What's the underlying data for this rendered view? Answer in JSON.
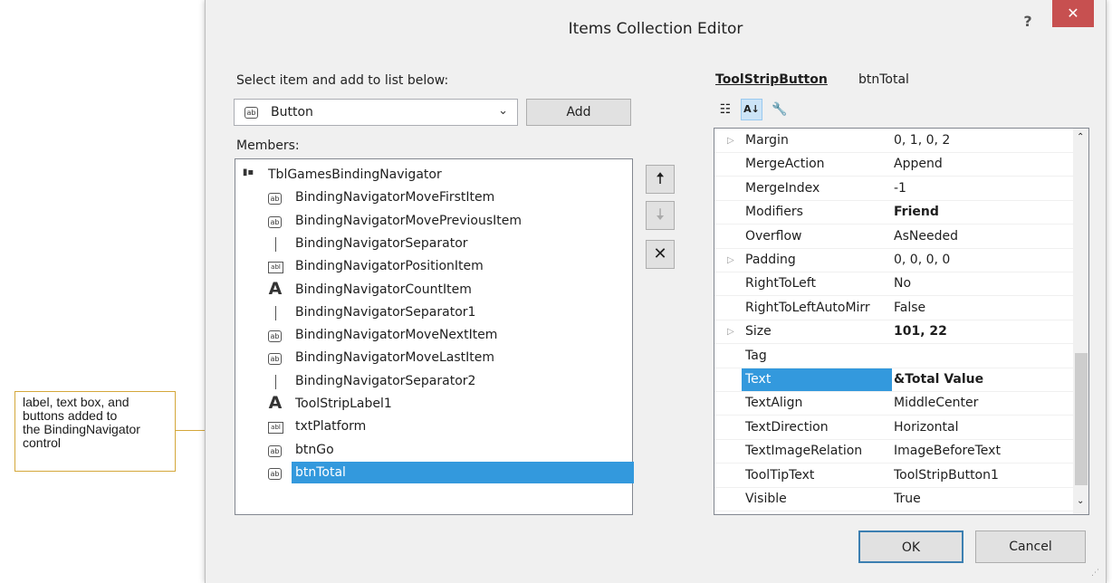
{
  "callout": {
    "text": "label, text box, and\nbuttons added to\nthe BindingNavigator\ncontrol"
  },
  "dialog": {
    "title": "Items Collection Editor",
    "help_label": "?",
    "close_label": "✕",
    "select_label": "Select item and add to list below:",
    "combo_value": "Button",
    "combo_icon": "ab",
    "add_label": "Add",
    "members_label": "Members:",
    "members": [
      {
        "icon": "toolstrip",
        "label": "TblGamesBindingNavigator"
      },
      {
        "icon": "ab",
        "label": "BindingNavigatorMoveFirstItem"
      },
      {
        "icon": "ab",
        "label": "BindingNavigatorMovePreviousItem"
      },
      {
        "icon": "sep",
        "label": "BindingNavigatorSeparator"
      },
      {
        "icon": "abl",
        "label": "BindingNavigatorPositionItem"
      },
      {
        "icon": "A",
        "label": "BindingNavigatorCountItem"
      },
      {
        "icon": "sep",
        "label": "BindingNavigatorSeparator1"
      },
      {
        "icon": "ab",
        "label": "BindingNavigatorMoveNextItem"
      },
      {
        "icon": "ab",
        "label": "BindingNavigatorMoveLastItem"
      },
      {
        "icon": "sep",
        "label": "BindingNavigatorSeparator2"
      },
      {
        "icon": "A",
        "label": "ToolStripLabel1"
      },
      {
        "icon": "abl",
        "label": "txtPlatform"
      },
      {
        "icon": "ab",
        "label": "btnGo"
      },
      {
        "icon": "ab",
        "label": "btnTotal"
      }
    ],
    "side_buttons": {
      "up": "🠅",
      "down": "🠇",
      "delete": "✕"
    },
    "props_type": "ToolStripButton",
    "props_name": "btnTotal",
    "properties": [
      {
        "name": "Margin",
        "value": "0, 1, 0, 2",
        "expand": "▷",
        "bold": false
      },
      {
        "name": "MergeAction",
        "value": "Append",
        "expand": "",
        "bold": false
      },
      {
        "name": "MergeIndex",
        "value": "-1",
        "expand": "",
        "bold": false
      },
      {
        "name": "Modifiers",
        "value": "Friend",
        "expand": "",
        "bold": true
      },
      {
        "name": "Overflow",
        "value": "AsNeeded",
        "expand": "",
        "bold": false
      },
      {
        "name": "Padding",
        "value": "0, 0, 0, 0",
        "expand": "▷",
        "bold": false
      },
      {
        "name": "RightToLeft",
        "value": "No",
        "expand": "",
        "bold": false
      },
      {
        "name": "RightToLeftAutoMirr",
        "value": "False",
        "expand": "",
        "bold": false
      },
      {
        "name": "Size",
        "value": "101, 22",
        "expand": "▷",
        "bold": true
      },
      {
        "name": "Tag",
        "value": "",
        "expand": "",
        "bold": false
      },
      {
        "name": "Text",
        "value": "&Total Value",
        "expand": "",
        "bold": true
      },
      {
        "name": "TextAlign",
        "value": "MiddleCenter",
        "expand": "",
        "bold": false
      },
      {
        "name": "TextDirection",
        "value": "Horizontal",
        "expand": "",
        "bold": false
      },
      {
        "name": "TextImageRelation",
        "value": "ImageBeforeText",
        "expand": "",
        "bold": false
      },
      {
        "name": "ToolTipText",
        "value": "ToolStripButton1",
        "expand": "",
        "bold": false
      },
      {
        "name": "Visible",
        "value": "True",
        "expand": "",
        "bold": false
      }
    ],
    "ok_label": "OK",
    "cancel_label": "Cancel"
  },
  "colors": {
    "selection": "#3399dd",
    "close": "#c75050",
    "callout_border": "#d4a73a"
  }
}
